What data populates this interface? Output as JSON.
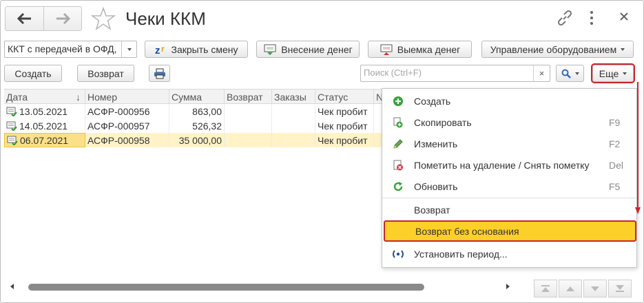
{
  "window": {
    "title": "Чеки ККМ"
  },
  "toolbar1": {
    "register_select": "ККТ с передачей в ОФД,",
    "close_shift": "Закрыть смену",
    "cash_in": "Внесение денег",
    "cash_out": "Выемка денег",
    "equipment": "Управление оборудованием"
  },
  "toolbar2": {
    "create": "Создать",
    "return": "Возврат",
    "search_placeholder": "Поиск (Ctrl+F)",
    "clear": "×",
    "more": "Еще"
  },
  "table": {
    "columns": [
      "Дата",
      "Номер",
      "Сумма",
      "Возврат",
      "Заказы",
      "Статус",
      "N"
    ],
    "sort_marker": "↓",
    "rows": [
      {
        "date": "13.05.2021",
        "number": "АСФР-000956",
        "amount": "863,00",
        "return": "",
        "orders": "",
        "status": "Чек пробит"
      },
      {
        "date": "14.05.2021",
        "number": "АСФР-000957",
        "amount": "526,32",
        "return": "",
        "orders": "",
        "status": "Чек пробит"
      },
      {
        "date": "06.07.2021",
        "number": "АСФР-000958",
        "amount": "35 000,00",
        "return": "",
        "orders": "",
        "status": "Чек пробит"
      }
    ]
  },
  "menu": {
    "items": [
      {
        "label": "Создать",
        "key": "",
        "icon": "plus-circle-icon"
      },
      {
        "label": "Скопировать",
        "key": "F9",
        "icon": "copy-icon"
      },
      {
        "label": "Изменить",
        "key": "F2",
        "icon": "pencil-icon"
      },
      {
        "label": "Пометить на удаление / Снять пометку",
        "key": "Del",
        "icon": "delete-mark-icon"
      },
      {
        "label": "Обновить",
        "key": "F5",
        "icon": "refresh-icon"
      },
      {
        "label": "Возврат",
        "key": "",
        "icon": ""
      },
      {
        "label": "Возврат без основания",
        "key": "",
        "icon": ""
      },
      {
        "label": "Установить период...",
        "key": "",
        "icon": "period-icon"
      }
    ]
  },
  "colors": {
    "accent_highlight": "#fcd028",
    "annotation_red": "#c8262c",
    "selected_row": "#fff3c7"
  }
}
